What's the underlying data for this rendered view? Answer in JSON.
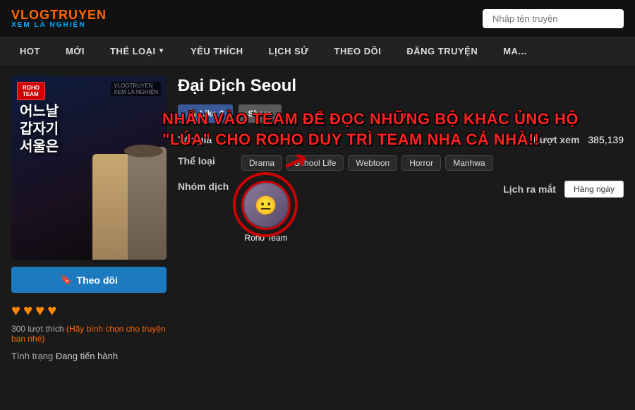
{
  "logo": {
    "top": "VLOGTRUYEN",
    "bottom": "XEM LÀ NGHIỆN"
  },
  "search": {
    "placeholder": "Nhập tên truyện"
  },
  "nav": {
    "items": [
      {
        "label": "HOT",
        "hasDropdown": false
      },
      {
        "label": "MỚI",
        "hasDropdown": false
      },
      {
        "label": "THỂ LOẠI",
        "hasDropdown": true
      },
      {
        "label": "YÊU THÍCH",
        "hasDropdown": false
      },
      {
        "label": "LỊCH SỬ",
        "hasDropdown": false
      },
      {
        "label": "THEO DÕI",
        "hasDropdown": false
      },
      {
        "label": "ĐĂNG TRUYỆN",
        "hasDropdown": false
      },
      {
        "label": "MA...",
        "hasDropdown": false
      }
    ]
  },
  "manga": {
    "title": "Đại Dịch Seoul",
    "title_korean": "어느날\n갑자기\n서울은",
    "like_count": 0,
    "like_label": "Like",
    "share_label": "Share",
    "overlay_message": "NHẤN VÀO TEAM ĐỂ ĐỌC NHỮNG BỘ KHÁC ỦNG HỘ \"LÚA\" CHO ROHO DUY TRÌ TEAM NHA CẢ NHÀ!!",
    "info": {
      "author_label": "Tác giả",
      "author_value": "",
      "views_label": "Lượt xem",
      "views_value": "385,139",
      "genre_label": "Thể loại",
      "genres": [
        "Drama",
        "School Life",
        "Webtoon",
        "Horror",
        "Manhwa"
      ],
      "group_label": "Nhóm dịch",
      "group_name": "Roho Team",
      "schedule_label": "Lịch ra mắt",
      "schedule_value": "Hàng ngày"
    }
  },
  "left": {
    "follow_label": "Theo dõi",
    "stars": 4,
    "likes_count": 300,
    "likes_text": "300 lượt thích",
    "likes_sub": "(Hãy bình chọn cho truyện bạn nhé)",
    "status_label": "Tình trạng",
    "status_value": "Đang tiến hành",
    "roho_label": "ROHO\nTEAM"
  }
}
